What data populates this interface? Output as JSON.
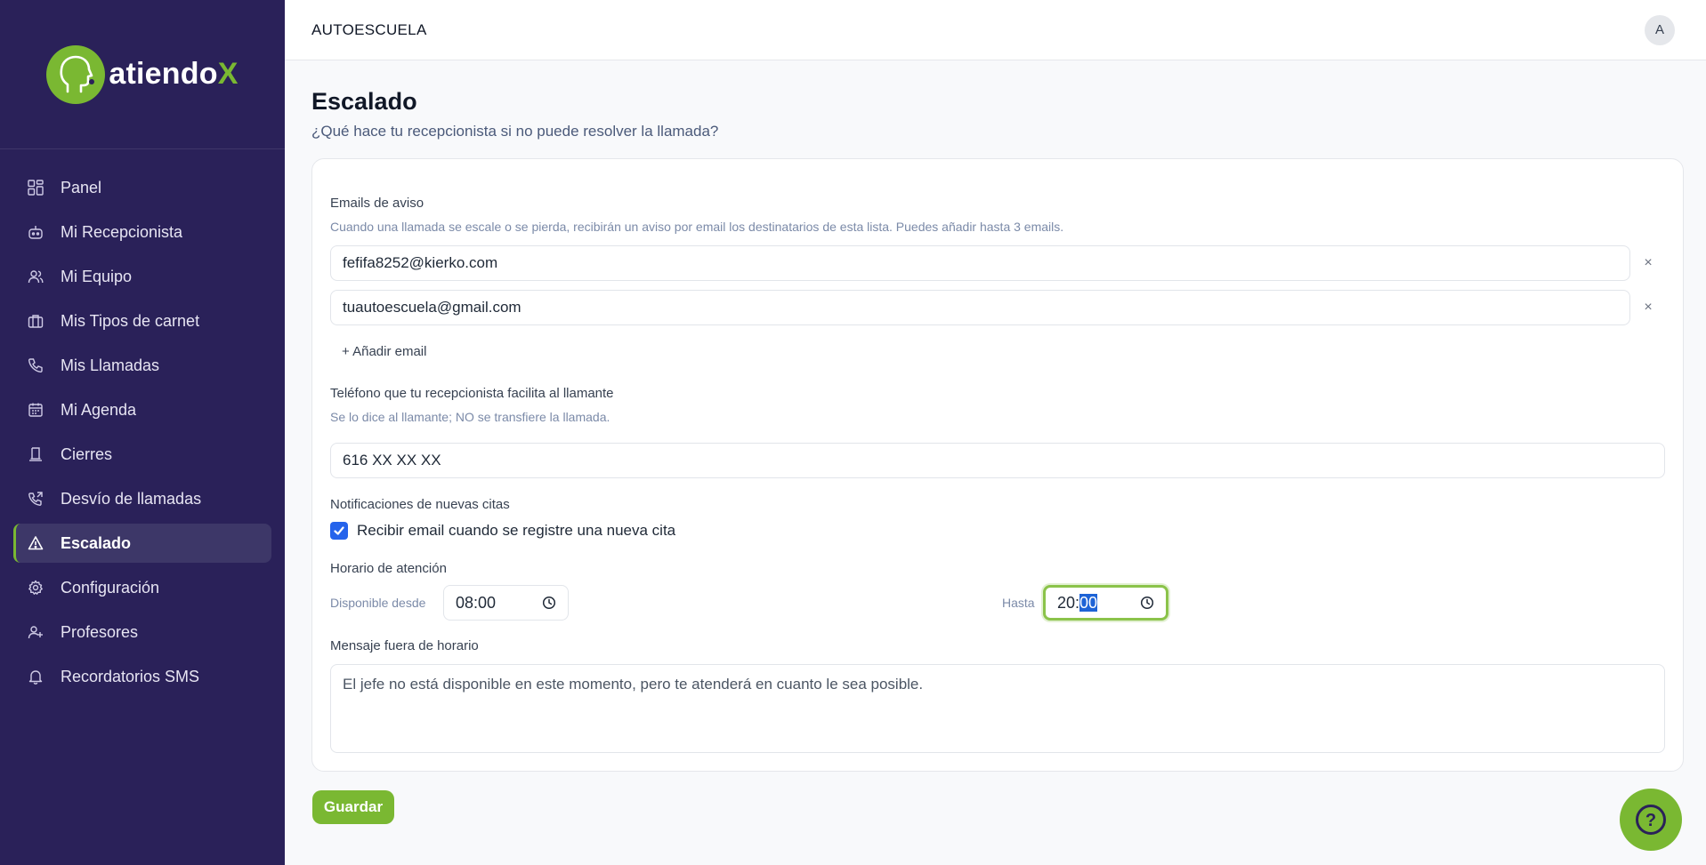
{
  "brand": {
    "name_main": "atiendo",
    "name_accent": "X",
    "accent_color": "#7ab832",
    "sidebar_color": "#2a2159"
  },
  "sidebar": {
    "items": [
      {
        "label": "Panel",
        "icon": "dashboard-icon"
      },
      {
        "label": "Mi Recepcionista",
        "icon": "robot-icon"
      },
      {
        "label": "Mi Equipo",
        "icon": "users-icon"
      },
      {
        "label": "Mis Tipos de carnet",
        "icon": "briefcase-icon"
      },
      {
        "label": "Mis Llamadas",
        "icon": "phone-icon"
      },
      {
        "label": "Mi Agenda",
        "icon": "calendar-icon"
      },
      {
        "label": "Cierres",
        "icon": "lamp-icon"
      },
      {
        "label": "Desvío de llamadas",
        "icon": "phone-forward-icon"
      },
      {
        "label": "Escalado",
        "icon": "warning-icon",
        "active": true
      },
      {
        "label": "Configuración",
        "icon": "gear-icon"
      },
      {
        "label": "Profesores",
        "icon": "user-plus-icon"
      },
      {
        "label": "Recordatorios SMS",
        "icon": "bell-icon"
      }
    ]
  },
  "topbar": {
    "org_name": "AUTOESCUELA",
    "avatar_initial": "A"
  },
  "page": {
    "title": "Escalado",
    "subtitle": "¿Qué hace tu recepcionista si no puede resolver la llamada?"
  },
  "emails": {
    "label": "Emails de aviso",
    "help": "Cuando una llamada se escale o se pierda, recibirán un aviso por email los destinatarios de esta lista. Puedes añadir hasta 3 emails.",
    "list": [
      "fefifa8252@kierko.com",
      "tuautoescuela@gmail.com"
    ],
    "remove_symbol": "×",
    "add_label": "+ Añadir email"
  },
  "phone": {
    "label": "Teléfono que tu recepcionista facilita al llamante",
    "help": "Se lo dice al llamante; NO se transfiere la llamada.",
    "value": "616 XX XX XX"
  },
  "notifications": {
    "label": "Notificaciones de nuevas citas",
    "checkbox_label": "Recibir email cuando se registre una nueva cita",
    "checked": true
  },
  "hours": {
    "label": "Horario de atención",
    "from_label": "Disponible desde",
    "from_value": "08:00",
    "to_label": "Hasta",
    "to_hours": "20:",
    "to_minutes": "00"
  },
  "off_hours": {
    "label": "Mensaje fuera de horario",
    "message": "El jefe no está disponible en este momento, pero te atenderá en cuanto le sea posible."
  },
  "actions": {
    "save_label": "Guardar",
    "help_symbol": "?"
  }
}
